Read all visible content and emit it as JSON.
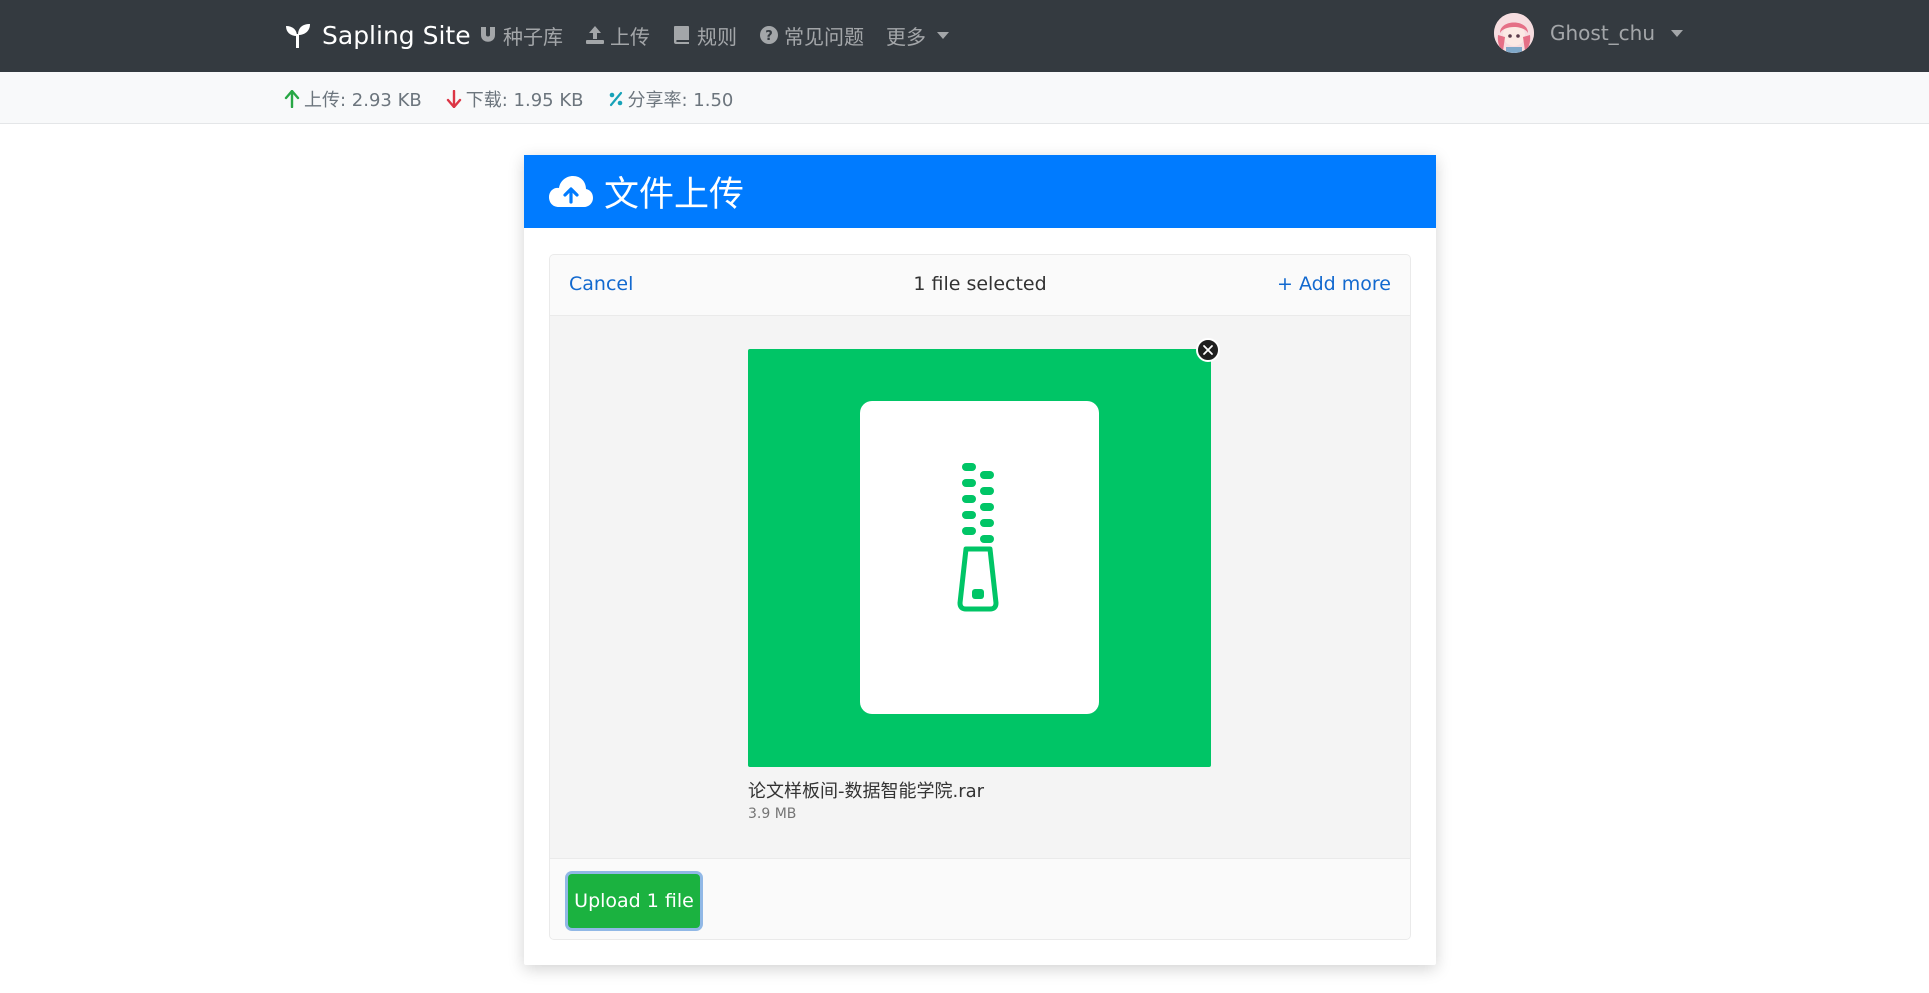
{
  "navbar": {
    "brand": "Sapling Site",
    "links": [
      {
        "label": "种子库",
        "icon": "magnet-icon"
      },
      {
        "label": "上传",
        "icon": "upload-icon"
      },
      {
        "label": "规则",
        "icon": "book-icon"
      },
      {
        "label": "常见问题",
        "icon": "question-circle-icon"
      },
      {
        "label": "更多",
        "icon": "caret-down-icon"
      }
    ],
    "username": "Ghost_chu"
  },
  "stats": {
    "upload": "上传: 2.93 KB",
    "download": "下载: 1.95 KB",
    "ratio": "分享率: 1.50",
    "colors": {
      "upload": "#28a745",
      "download": "#dc3545",
      "ratio": "#17a2b8"
    }
  },
  "card": {
    "title": "文件上传",
    "header_color": "#007bff"
  },
  "uploader": {
    "cancel": "Cancel",
    "title": "1 file selected",
    "add_more": "+ Add more",
    "file": {
      "name": "论文样板间-数据智能学院.rar",
      "size": "3.9 MB",
      "icon": "zip-archive-icon",
      "preview_color": "#00c566"
    },
    "upload_button": "Upload 1 file"
  }
}
